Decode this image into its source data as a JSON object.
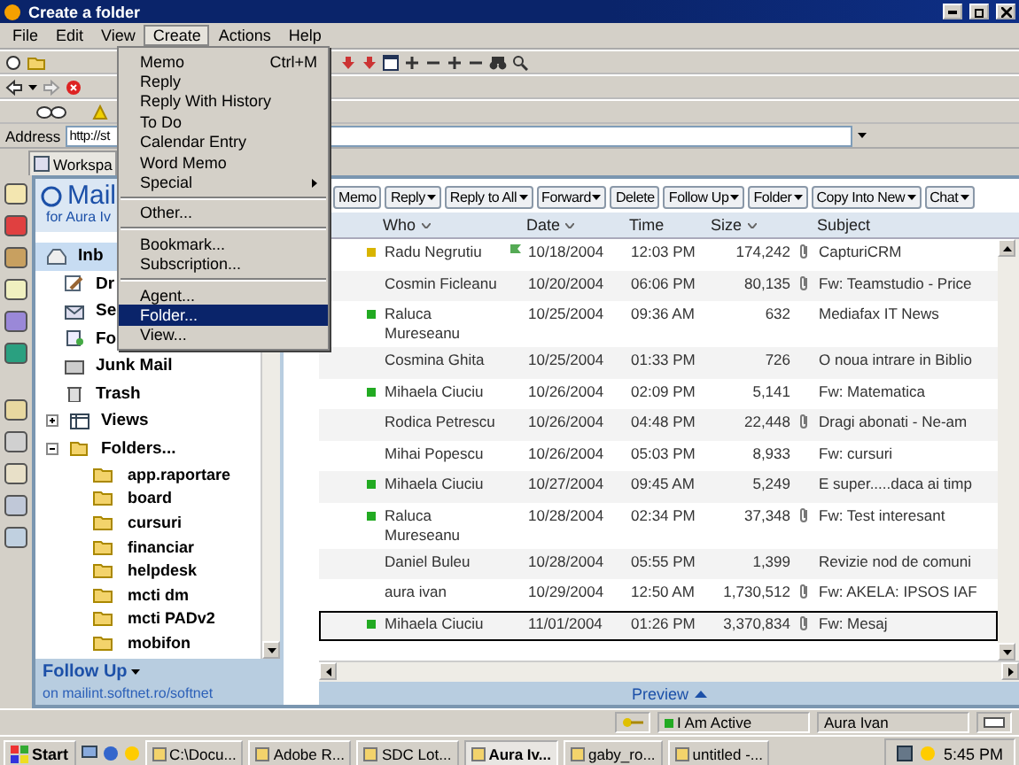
{
  "window": {
    "title": "Create a folder"
  },
  "menu_bar": [
    {
      "label": "File",
      "selected": false
    },
    {
      "label": "Edit",
      "selected": false
    },
    {
      "label": "View",
      "selected": false
    },
    {
      "label": "Create",
      "selected": true
    },
    {
      "label": "Actions",
      "selected": false
    },
    {
      "label": "Help",
      "selected": false
    }
  ],
  "create_menu": [
    {
      "kind": "item",
      "label": "Memo",
      "shortcut": "Ctrl+M",
      "selected": false
    },
    {
      "kind": "item",
      "label": "Reply",
      "selected": false
    },
    {
      "kind": "item",
      "label": "Reply With History",
      "selected": false
    },
    {
      "kind": "item",
      "label": "To Do",
      "selected": false
    },
    {
      "kind": "item",
      "label": "Calendar Entry",
      "selected": false
    },
    {
      "kind": "item",
      "label": "Word Memo",
      "selected": false
    },
    {
      "kind": "submenu",
      "label": "Special",
      "selected": false
    },
    {
      "kind": "separator"
    },
    {
      "kind": "item",
      "label": "Other...",
      "selected": false
    },
    {
      "kind": "separator"
    },
    {
      "kind": "item",
      "label": "Bookmark...",
      "selected": false
    },
    {
      "kind": "item",
      "label": "Subscription...",
      "selected": false
    },
    {
      "kind": "separator"
    },
    {
      "kind": "item",
      "label": "Agent...",
      "selected": false
    },
    {
      "kind": "item",
      "label": "Folder...",
      "selected": true
    },
    {
      "kind": "item",
      "label": "View...",
      "selected": false
    }
  ],
  "address_bar": {
    "label": "Address",
    "value": "http://st"
  },
  "workspace_tab": {
    "label": "Workspa"
  },
  "mail_pane": {
    "title": "Mail",
    "owner": "for Aura Iv",
    "nav": [
      {
        "kind": "inbox",
        "label": "Inb",
        "selected": true
      },
      {
        "kind": "drafts",
        "label": "Dr",
        "selected": false
      },
      {
        "kind": "sent",
        "label": "Se",
        "selected": false
      },
      {
        "kind": "follow",
        "label": "Fo",
        "selected": false
      },
      {
        "kind": "junk",
        "label": "Junk Mail",
        "selected": false
      },
      {
        "kind": "trash",
        "label": "Trash",
        "selected": false
      },
      {
        "kind": "views",
        "label": "Views",
        "selected": false,
        "expanded": false
      },
      {
        "kind": "folders",
        "label": "Folders...",
        "selected": false,
        "expanded": true,
        "children": [
          {
            "label": "app.raportare",
            "selected": false
          },
          {
            "label": "board",
            "selected": false
          },
          {
            "label": "cursuri",
            "selected": false
          },
          {
            "label": "financiar",
            "selected": false
          },
          {
            "label": "helpdesk",
            "selected": false
          },
          {
            "label": "mcti dm",
            "selected": false
          },
          {
            "label": "mcti PADv2",
            "selected": false
          },
          {
            "label": "mobifon",
            "selected": false
          }
        ]
      }
    ],
    "footer_title": "Follow Up",
    "server": "on mailint.softnet.ro/softnet"
  },
  "action_bar": [
    {
      "label": "Memo",
      "dropdown": false
    },
    {
      "label": "Reply",
      "dropdown": true
    },
    {
      "label": "Reply to All",
      "dropdown": true
    },
    {
      "label": "Forward",
      "dropdown": true
    },
    {
      "label": "Delete",
      "dropdown": false
    },
    {
      "label": "Follow Up",
      "dropdown": true
    },
    {
      "label": "Folder",
      "dropdown": true
    },
    {
      "label": "Copy Into New",
      "dropdown": true
    },
    {
      "label": "Chat",
      "dropdown": true
    }
  ],
  "columns": [
    {
      "label": "Who",
      "sortable": true
    },
    {
      "label": "Date",
      "sortable": true
    },
    {
      "label": "Time",
      "sortable": false
    },
    {
      "label": "Size",
      "sortable": true
    },
    {
      "label": "Subject",
      "sortable": false
    }
  ],
  "rows": [
    {
      "who": "Radu Negrutiu",
      "date": "10/18/2004",
      "time": "12:03 PM",
      "size": "174,242",
      "attachment": true,
      "flag": true,
      "subject": "CapturiCRM",
      "color": "#d8b400",
      "selected": false
    },
    {
      "who": "Cosmin Ficleanu",
      "date": "10/20/2004",
      "time": "06:06 PM",
      "size": "80,135",
      "attachment": true,
      "flag": false,
      "subject": "Fw: Teamstudio - Price",
      "selected": false
    },
    {
      "who": "Raluca Mureseanu",
      "date": "10/25/2004",
      "time": "09:36 AM",
      "size": "632",
      "attachment": false,
      "flag": false,
      "subject": "Mediafax IT News",
      "color": "#22aa22",
      "selected": false
    },
    {
      "who": "Cosmina Ghita",
      "date": "10/25/2004",
      "time": "01:33 PM",
      "size": "726",
      "attachment": false,
      "flag": false,
      "subject": "O noua intrare in Biblio",
      "selected": false
    },
    {
      "who": "Mihaela Ciuciu",
      "date": "10/26/2004",
      "time": "02:09 PM",
      "size": "5,141",
      "attachment": false,
      "flag": false,
      "subject": "Fw: Matematica",
      "color": "#22aa22",
      "selected": false
    },
    {
      "who": "Rodica Petrescu",
      "date": "10/26/2004",
      "time": "04:48 PM",
      "size": "22,448",
      "attachment": true,
      "flag": false,
      "subject": "Dragi abonati -  Ne-am",
      "selected": false
    },
    {
      "who": "Mihai Popescu",
      "date": "10/26/2004",
      "time": "05:03 PM",
      "size": "8,933",
      "attachment": false,
      "flag": false,
      "subject": "Fw: cursuri",
      "selected": false
    },
    {
      "who": "Mihaela Ciuciu",
      "date": "10/27/2004",
      "time": "09:45 AM",
      "size": "5,249",
      "attachment": false,
      "flag": false,
      "subject": "E super.....daca ai timp",
      "color": "#22aa22",
      "selected": false
    },
    {
      "who": "Raluca Mureseanu",
      "date": "10/28/2004",
      "time": "02:34 PM",
      "size": "37,348",
      "attachment": true,
      "flag": false,
      "subject": "Fw: Test interesant",
      "color": "#22aa22",
      "selected": false
    },
    {
      "who": "Daniel Buleu",
      "date": "10/28/2004",
      "time": "05:55 PM",
      "size": "1,399",
      "attachment": false,
      "flag": false,
      "subject": "Revizie nod de comuni",
      "selected": false
    },
    {
      "who": "aura ivan",
      "date": "10/29/2004",
      "time": "12:50 AM",
      "size": "1,730,512",
      "attachment": true,
      "flag": false,
      "subject": "Fw: AKELA: IPSOS IAF",
      "selected": false
    },
    {
      "who": "Mihaela Ciuciu",
      "date": "11/01/2004",
      "time": "01:26 PM",
      "size": "3,370,834",
      "attachment": true,
      "flag": false,
      "subject": "Fw: Mesaj",
      "color": "#22aa22",
      "selected": true
    }
  ],
  "preview": {
    "label": "Preview"
  },
  "status_bar": {
    "status": "I Am Active",
    "user": "Aura Ivan"
  },
  "taskbar": {
    "start": "Start",
    "tasks": [
      {
        "label": "C:\\Docu...",
        "selected": false
      },
      {
        "label": "Adobe R...",
        "selected": false
      },
      {
        "label": "SDC Lot...",
        "selected": false
      },
      {
        "label": "Aura Iv...",
        "selected": true
      },
      {
        "label": "gaby_ro...",
        "selected": false
      },
      {
        "label": "untitled -...",
        "selected": false
      }
    ],
    "clock": "5:45 PM"
  }
}
